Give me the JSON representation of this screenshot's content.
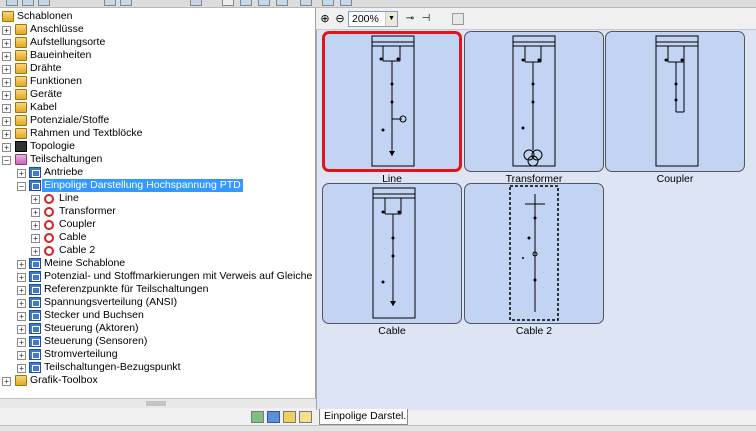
{
  "tree": {
    "root_label": "Schablonen",
    "items": [
      {
        "label": "Anschlüsse",
        "icon": "connector-icon"
      },
      {
        "label": "Aufstellungsorte",
        "icon": "location-icon"
      },
      {
        "label": "Baueinheiten",
        "icon": "unit-icon"
      },
      {
        "label": "Drähte",
        "icon": "wire-icon"
      },
      {
        "label": "Funktionen",
        "icon": "function-icon"
      },
      {
        "label": "Geräte",
        "icon": "device-icon"
      },
      {
        "label": "Kabel",
        "icon": "cable-icon"
      },
      {
        "label": "Potenziale/Stoffe",
        "icon": "potential-icon"
      },
      {
        "label": "Rahmen und Textblöcke",
        "icon": "frame-icon"
      },
      {
        "label": "Topologie",
        "icon": "topology-icon"
      },
      {
        "label": "Teilschaltungen",
        "icon": "subcircuit-folder-icon"
      }
    ],
    "teilschaltungen_children": [
      {
        "label": "Antriebe"
      },
      {
        "label": "Einpolige Darstellung Hochspannung PTD",
        "selected": true
      },
      {
        "label": "Meine Schablone"
      },
      {
        "label": "Potenzial- und Stoffmarkierungen mit Verweis auf Gleiche"
      },
      {
        "label": "Referenzpunkte für Teilschaltungen"
      },
      {
        "label": "Spannungsverteilung (ANSI)"
      },
      {
        "label": "Stecker und Buchsen"
      },
      {
        "label": "Steuerung (Aktoren)"
      },
      {
        "label": "Steuerung (Sensoren)"
      },
      {
        "label": "Stromverteilung"
      },
      {
        "label": "Teilschaltungen-Bezugspunkt"
      }
    ],
    "ptd_children": [
      "Line",
      "Transformer",
      "Coupler",
      "Cable",
      "Cable 2"
    ],
    "last_item": "Grafik-Toolbox"
  },
  "toolbar": {
    "zoom_value": "200%",
    "zoom_in_icon": "zoom-in-icon",
    "zoom_out_icon": "zoom-out-icon"
  },
  "templates": [
    {
      "label": "Line",
      "selected": true
    },
    {
      "label": "Transformer",
      "selected": false
    },
    {
      "label": "Coupler",
      "selected": false
    },
    {
      "label": "Cable",
      "selected": false
    },
    {
      "label": "Cable 2",
      "selected": false
    }
  ],
  "tab": {
    "label": "Einpolige Darstel..."
  },
  "colors": {
    "selection": "#3399ff",
    "canvas_bg": "#dde5f5",
    "card_bg": "#c3d3f4",
    "card_selected_border": "#e0131d"
  }
}
